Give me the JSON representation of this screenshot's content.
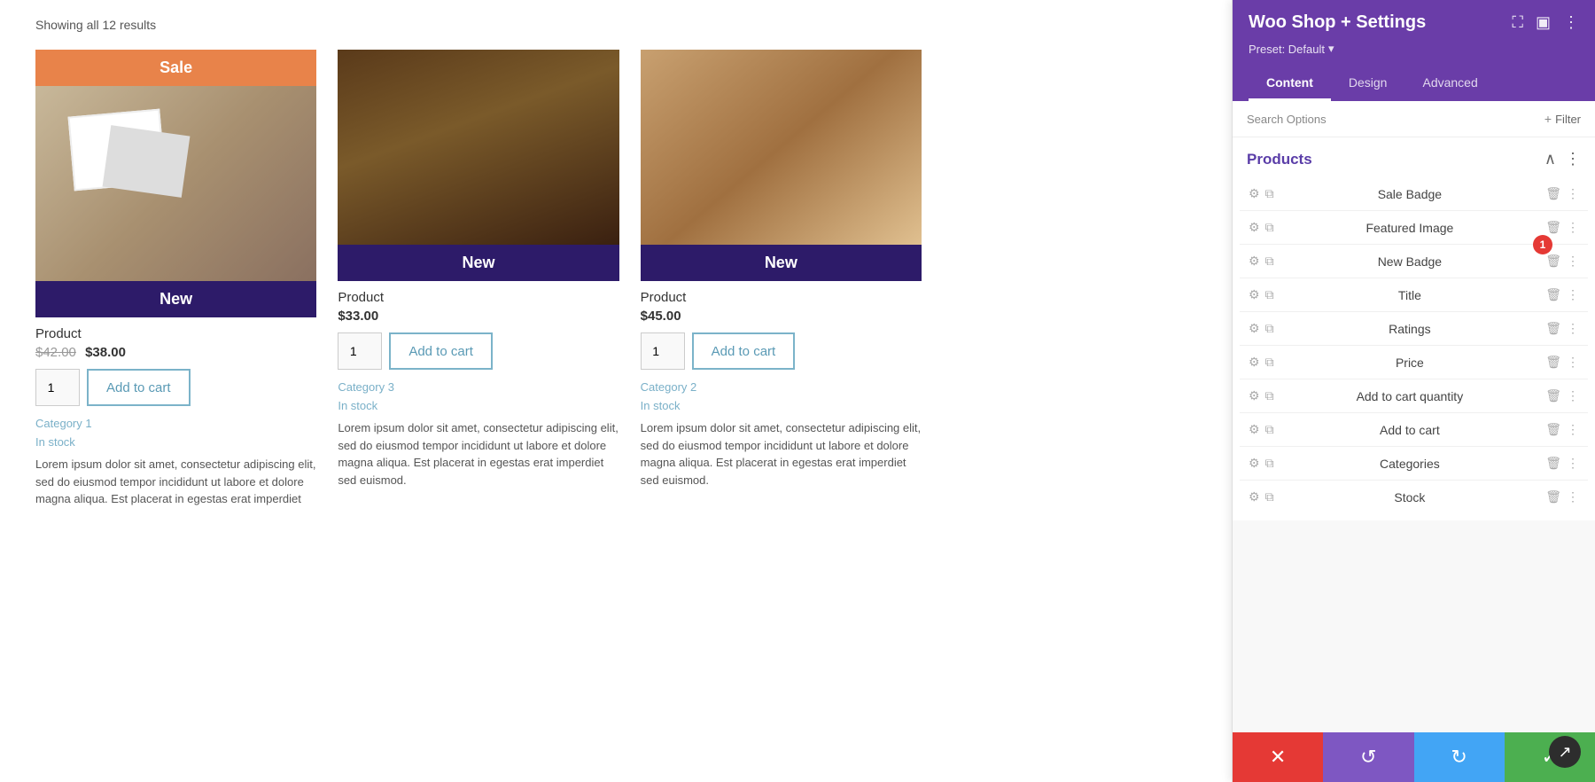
{
  "main": {
    "results_count": "Showing all 12 results"
  },
  "products": [
    {
      "id": "product-1",
      "badge": "Sale",
      "badge_type": "sale",
      "new_badge": "New",
      "name": "Product",
      "price_original": "$42.00",
      "price_sale": "$38.00",
      "qty": "1",
      "add_to_cart": "Add to cart",
      "category": "Category 1",
      "stock": "In stock",
      "desc": "Lorem ipsum dolor sit amet, consectetur adipiscing elit, sed do eiusmod tempor incididunt ut labore et dolore magna aliqua. Est placerat in egestas erat imperdiet"
    },
    {
      "id": "product-2",
      "badge": "New",
      "badge_type": "new",
      "new_badge": "",
      "name": "Product",
      "price_original": "",
      "price_sale": "$33.00",
      "qty": "1",
      "add_to_cart": "Add to cart",
      "category": "Category 3",
      "stock": "In stock",
      "desc": "Lorem ipsum dolor sit amet, consectetur adipiscing elit, sed do eiusmod tempor incididunt ut labore et dolore magna aliqua. Est placerat in egestas erat imperdiet sed euismod."
    },
    {
      "id": "product-3",
      "badge": "New",
      "badge_type": "new",
      "new_badge": "",
      "name": "Product",
      "price_original": "",
      "price_sale": "$45.00",
      "qty": "1",
      "add_to_cart": "Add to cart",
      "category": "Category 2",
      "stock": "In stock",
      "desc": "Lorem ipsum dolor sit amet, consectetur adipiscing elit, sed do eiusmod tempor incididunt ut labore et dolore magna aliqua. Est placerat in egestas erat imperdiet sed euismod."
    }
  ],
  "panel": {
    "title": "Woo Shop + Settings",
    "preset_label": "Preset: Default",
    "tabs": [
      {
        "id": "content",
        "label": "Content",
        "active": true
      },
      {
        "id": "design",
        "label": "Design",
        "active": false
      },
      {
        "id": "advanced",
        "label": "Advanced",
        "active": false
      }
    ],
    "search_options_placeholder": "Search Options",
    "filter_label": "Filter",
    "sections": [
      {
        "id": "products",
        "title": "Products",
        "items": [
          {
            "id": "sale-badge",
            "label": "Sale Badge"
          },
          {
            "id": "featured-image",
            "label": "Featured Image"
          },
          {
            "id": "new-badge",
            "label": "New Badge",
            "has_badge": true,
            "badge_num": "1"
          },
          {
            "id": "title",
            "label": "Title"
          },
          {
            "id": "ratings",
            "label": "Ratings"
          },
          {
            "id": "price",
            "label": "Price"
          },
          {
            "id": "add-to-cart-quantity",
            "label": "Add to cart quantity"
          },
          {
            "id": "add-to-cart",
            "label": "Add to cart"
          },
          {
            "id": "categories",
            "label": "Categories"
          },
          {
            "id": "stock",
            "label": "Stock"
          }
        ]
      }
    ]
  },
  "action_bar": {
    "close_label": "✕",
    "undo_label": "↺",
    "redo_label": "↻",
    "save_label": "✓"
  },
  "icons": {
    "gear": "⚙",
    "copy": "⧉",
    "trash": "🗑",
    "more": "⋮",
    "chevron_up": "^",
    "dots_menu": "⋮",
    "screenshot": "⛶",
    "layout": "▣",
    "ellipsis": "⋮",
    "arrow_icon": "↗"
  }
}
